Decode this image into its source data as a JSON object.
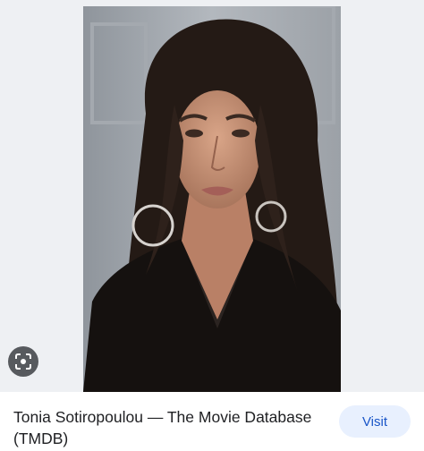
{
  "image_viewer": {
    "photo_alt": "Tonia Sotiropoulou",
    "lens_icon": "google-lens-icon"
  },
  "result": {
    "title": "Tonia Sotiropoulou — The Movie Database (TMDB)",
    "visit_label": "Visit"
  },
  "colors": {
    "panel_background": "#eef0f3",
    "visit_background": "#e8f0fe",
    "visit_text": "#1a56c8",
    "title_text": "#202124"
  }
}
